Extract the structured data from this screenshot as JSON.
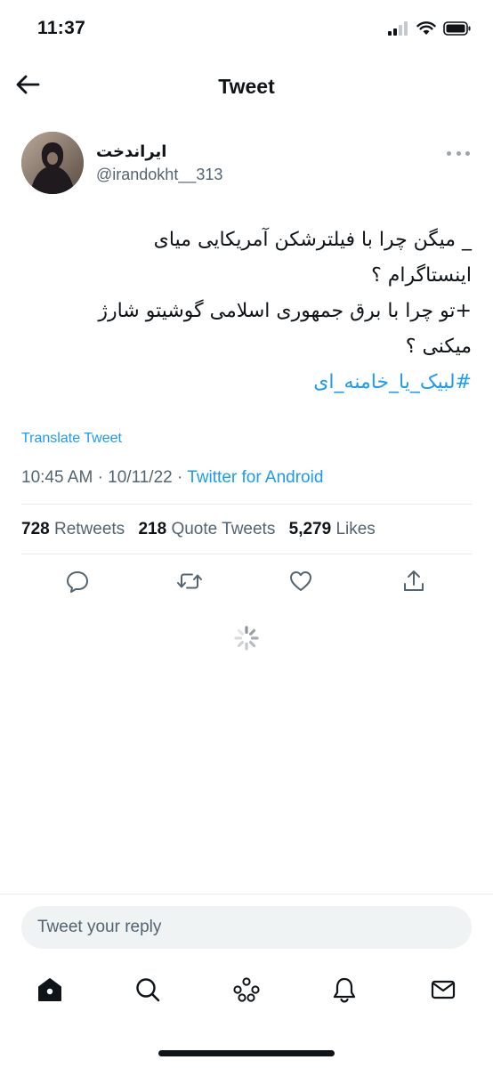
{
  "status_bar": {
    "time": "11:37",
    "icons": [
      "cellular-signal-icon",
      "wifi-icon",
      "battery-icon"
    ]
  },
  "header": {
    "title": "Tweet",
    "back_icon": "arrow-left-icon"
  },
  "author": {
    "name": "ایراندخت",
    "handle": "@irandokht__313",
    "more_icon": "more-dots-icon"
  },
  "tweet": {
    "lines": [
      "_ میگن چرا با فیلترشکن آمریکایی میای",
      "اینستاگرام ؟",
      "+تو چرا با برق جمهوری اسلامی گوشیتو شارژ",
      "میکنی ؟"
    ],
    "hashtag": "#لبیک_یا_خامنه_ای",
    "translate_label": "Translate Tweet",
    "time": "10:45 AM",
    "separator": "·",
    "date": "10/11/22",
    "source": "Twitter for Android"
  },
  "stats": {
    "retweets_count": "728",
    "retweets_label": "Retweets",
    "quotes_count": "218",
    "quotes_label": "Quote Tweets",
    "likes_count": "5,279",
    "likes_label": "Likes"
  },
  "actions": [
    "reply-icon",
    "retweet-icon",
    "like-icon",
    "share-icon"
  ],
  "reply": {
    "placeholder": "Tweet your reply"
  },
  "tabbar": [
    "home-icon",
    "search-icon",
    "spaces-icon",
    "notifications-icon",
    "messages-icon"
  ],
  "colors": {
    "accent": "#1d9bf0",
    "text": "#0f1419",
    "secondary": "#536471",
    "divider": "#e6ecf0"
  }
}
